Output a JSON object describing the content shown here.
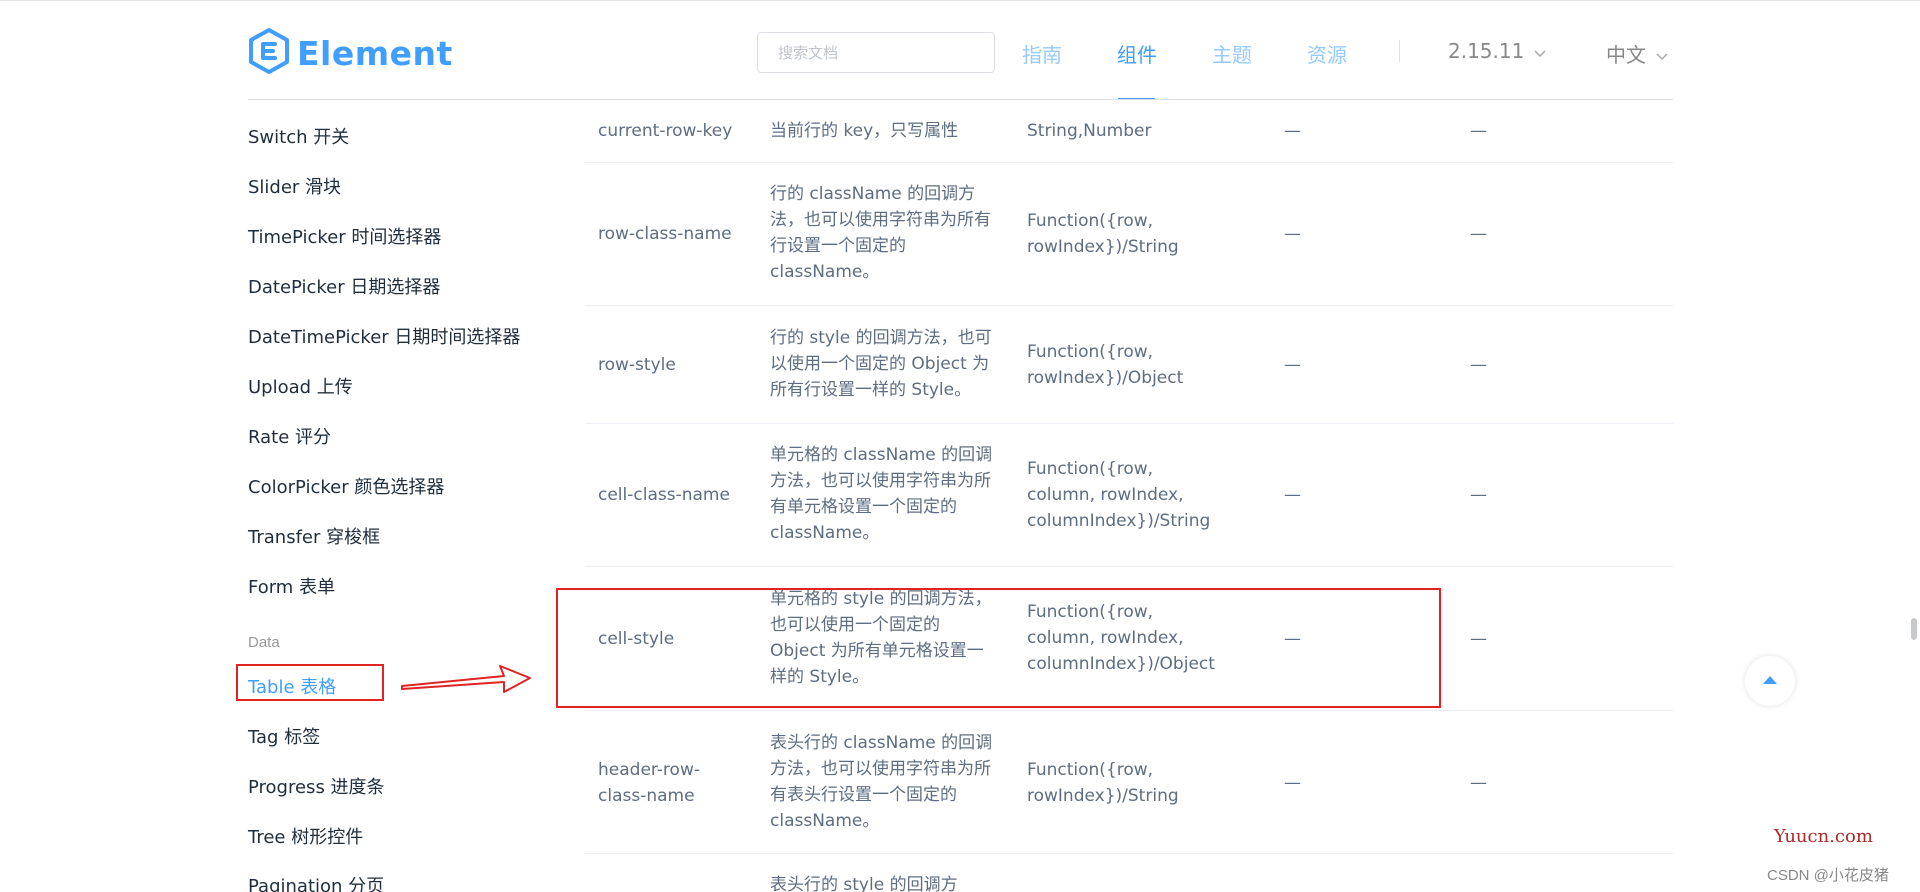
{
  "header": {
    "logo_text": "Element",
    "search_placeholder": "搜索文档",
    "nav": [
      "指南",
      "组件",
      "主题",
      "资源"
    ],
    "version": "2.15.11",
    "language": "中文",
    "brand_color": "#409eff"
  },
  "sidebar": {
    "items_top": [
      "Switch 开关",
      "Slider 滑块",
      "TimePicker 时间选择器",
      "DatePicker 日期选择器",
      "DateTimePicker 日期时间选择器",
      "Upload 上传",
      "Rate 评分",
      "ColorPicker 颜色选择器",
      "Transfer 穿梭框",
      "Form 表单"
    ],
    "group_label": "Data",
    "active_item": "Table 表格",
    "items_bottom": [
      "Tag 标签",
      "Progress 进度条",
      "Tree 树形控件",
      "Pagination 分页"
    ]
  },
  "table": {
    "rows": [
      {
        "name": "current-row-key",
        "desc": "当前行的 key，只写属性",
        "type": "String,Number",
        "option": "—",
        "default": "—"
      },
      {
        "name": "row-class-name",
        "desc": "行的 className 的回调方法，也可以使用字符串为所有行设置一个固定的 className。",
        "type": "Function({row, rowIndex})/String",
        "option": "—",
        "default": "—"
      },
      {
        "name": "row-style",
        "desc": "行的 style 的回调方法，也可以使用一个固定的 Object 为所有行设置一样的 Style。",
        "type": "Function({row, rowIndex})/Object",
        "option": "—",
        "default": "—"
      },
      {
        "name": "cell-class-name",
        "desc": "单元格的 className 的回调方法，也可以使用字符串为所有单元格设置一个固定的 className。",
        "type": "Function({row, column, rowIndex, columnIndex})/String",
        "option": "—",
        "default": "—"
      },
      {
        "name": "cell-style",
        "desc": "单元格的 style 的回调方法，也可以使用一个固定的 Object 为所有单元格设置一样的 Style。",
        "type": "Function({row, column, rowIndex, columnIndex})/Object",
        "option": "—",
        "default": "—"
      },
      {
        "name": "header-row-class-name",
        "desc": "表头行的 className 的回调方法，也可以使用字符串为所有表头行设置一个固定的 className。",
        "type": "Function({row, rowIndex})/String",
        "option": "—",
        "default": "—"
      },
      {
        "name": "",
        "desc": "表头行的 style 的回调方",
        "type": "",
        "option": "",
        "default": ""
      }
    ]
  },
  "watermark": "Yuucn.com",
  "credit": "CSDN @小花皮猪",
  "annotation_color": "#e02424"
}
